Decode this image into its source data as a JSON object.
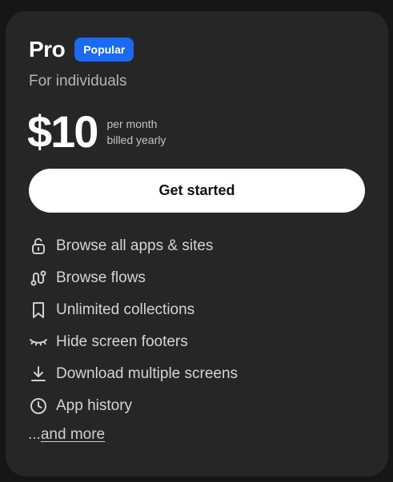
{
  "plan": {
    "name": "Pro",
    "badge": "Popular",
    "subtitle": "For individuals",
    "price": "$10",
    "price_note_line1": "per month",
    "price_note_line2": "billed yearly",
    "cta_label": "Get started"
  },
  "features": [
    {
      "icon": "unlock-icon",
      "label": "Browse all apps & sites"
    },
    {
      "icon": "flow-icon",
      "label": "Browse flows"
    },
    {
      "icon": "bookmark-icon",
      "label": "Unlimited collections"
    },
    {
      "icon": "eye-closed-icon",
      "label": "Hide screen footers"
    },
    {
      "icon": "download-icon",
      "label": "Download multiple screens"
    },
    {
      "icon": "clock-icon",
      "label": "App history"
    }
  ],
  "more": {
    "prefix": "...",
    "link_label": "and more"
  },
  "colors": {
    "background": "#161616",
    "card": "#262626",
    "badge": "#1a6af4",
    "cta_bg": "#ffffff"
  }
}
